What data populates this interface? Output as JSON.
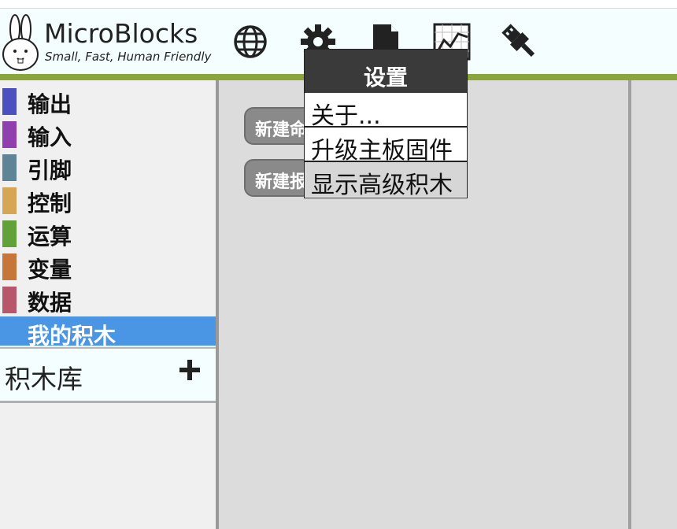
{
  "app": {
    "title": "MicroBlocks",
    "tagline": "Small, Fast, Human Friendly"
  },
  "toolbar": {
    "icons": [
      "globe-icon",
      "gear-icon",
      "file-icon",
      "graph-icon",
      "usb-plug-icon"
    ]
  },
  "palette": {
    "categories": [
      {
        "label": "输出",
        "color": "#4b4fbf"
      },
      {
        "label": "输入",
        "color": "#8f3fae"
      },
      {
        "label": "引脚",
        "color": "#5f8496"
      },
      {
        "label": "控制",
        "color": "#d7a556"
      },
      {
        "label": "运算",
        "color": "#62a03a"
      },
      {
        "label": "变量",
        "color": "#c7763a"
      },
      {
        "label": "数据",
        "color": "#b8566a"
      },
      {
        "label": "我的积木",
        "color": "#4a96e4"
      }
    ],
    "library_label": "积木库"
  },
  "scripts": {
    "buttons": [
      "新建命令积木",
      "新建报告积木"
    ]
  },
  "settings_menu": {
    "title": "设置",
    "items": [
      "关于...",
      "升级主板固件",
      "显示高级积木"
    ]
  }
}
